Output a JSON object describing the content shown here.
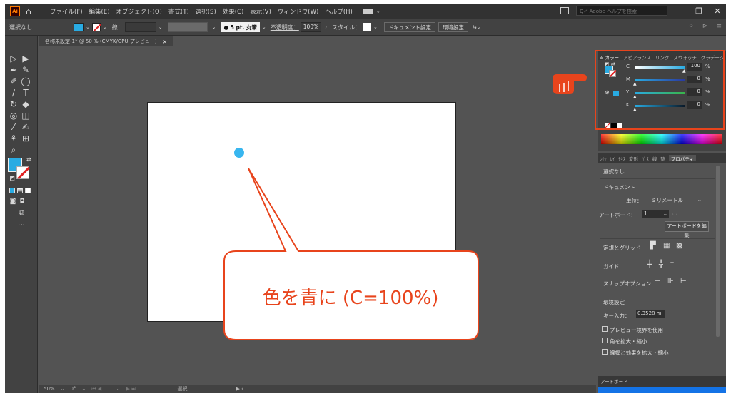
{
  "app": {
    "logo": "Ai"
  },
  "menu": {
    "items": [
      "ファイル(F)",
      "編集(E)",
      "オブジェクト(O)",
      "書式(T)",
      "選択(S)",
      "効果(C)",
      "表示(V)",
      "ウィンドウ(W)",
      "ヘルプ(H)"
    ],
    "search_placeholder": "Q✓ Adobe ヘルプを検索"
  },
  "control_bar": {
    "selection_label": "選択なし",
    "stroke_label": "線：",
    "brush": "● 5 pt. 丸筆",
    "opacity_label": "不透明度：",
    "opacity_value": "100%",
    "style_label": "スタイル：",
    "doc_setup_button": "ドキュメント設定",
    "prefs_button": "環境設定"
  },
  "document_tab": {
    "title": "名称未設定-1* @ 50 % (CMYK/GPU プレビュー)",
    "close": "×"
  },
  "color_panel": {
    "tabs": [
      "≑ カラー",
      "アピアランス",
      "リンク",
      "スウォッチ",
      "グラデーシ"
    ],
    "sliders": [
      {
        "label": "C",
        "value": "100",
        "unit": "%",
        "color": "#29abe2"
      },
      {
        "label": "M",
        "value": "0",
        "unit": "%",
        "color": "#e6007e"
      },
      {
        "label": "Y",
        "value": "0",
        "unit": "%",
        "color": "#ffe600"
      },
      {
        "label": "K",
        "value": "0",
        "unit": "%",
        "color": "#222222"
      }
    ]
  },
  "properties_panel": {
    "tabs": [
      "ﾚｲﾔ",
      "ﾚｲ",
      "ﾃｷｽ",
      "変形",
      "ﾊﾟｽ",
      "線",
      "整",
      "プロパティ"
    ],
    "no_selection": "選択なし",
    "document_heading": "ドキュメント",
    "unit_label": "単位：",
    "unit_value": "ミリメートル",
    "artboard_label": "アートボード：",
    "artboard_value": "1",
    "edit_artboard_button": "アートボードを編集",
    "rulers_label": "定規とグリッド",
    "guides_label": "ガイド",
    "snap_label": "スナップオプション",
    "prefs_heading": "環境設定",
    "key_input_label": "キー入力：",
    "key_input_value": "0.3528 m",
    "checkbox_preview": "プレビュー境界を使用",
    "checkbox_corners": "角を拡大・縮小",
    "checkbox_strokes": "線幅と効果を拡大・縮小"
  },
  "artboard_panel": {
    "title": "アートボード"
  },
  "status_bar": {
    "zoom": "50%",
    "rotation": "0°",
    "artboard": "1",
    "tool": "選択"
  },
  "annotation": {
    "callout_text": "色を青に (C=100%)",
    "accent_color": "#e8441c",
    "dot_color": "#38b6ef"
  }
}
